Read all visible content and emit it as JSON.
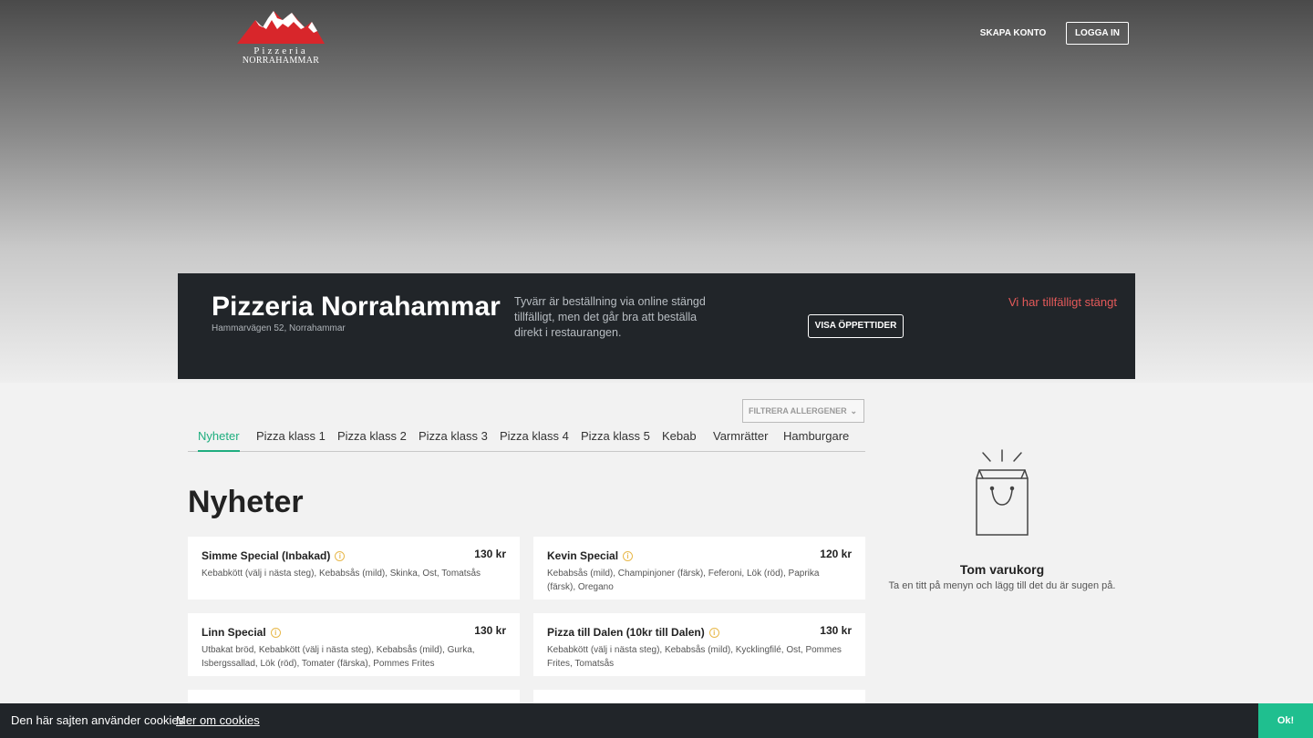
{
  "header": {
    "logo_line1": "Pizzeria",
    "logo_line2": "NORRAHAMMAR",
    "signup_label": "SKAPA KONTO",
    "login_label": "LOGGA IN"
  },
  "restaurant": {
    "name": "Pizzeria Norrahammar",
    "address": "Hammarvägen 52, Norrahammar",
    "closed_message": "Tyvärr är beställning via online stängd tillfälligt, men det går bra att beställa direkt i restaurangen.",
    "hours_button": "VISA ÖPPETTIDER",
    "status": "Vi har tillfälligt stängt"
  },
  "filter": {
    "allergen_label": "FILTRERA ALLERGENER",
    "chevron_icon": "chevron-down-icon"
  },
  "categories": [
    {
      "label": "Nyheter",
      "active": true
    },
    {
      "label": "Pizza klass 1",
      "active": false
    },
    {
      "label": "Pizza klass 2",
      "active": false
    },
    {
      "label": "Pizza klass 3",
      "active": false
    },
    {
      "label": "Pizza klass 4",
      "active": false
    },
    {
      "label": "Pizza klass 5",
      "active": false
    },
    {
      "label": "Kebab",
      "active": false
    },
    {
      "label": "Varmrätter",
      "active": false
    },
    {
      "label": "Hamburgare",
      "active": false
    }
  ],
  "section": {
    "title": "Nyheter"
  },
  "menu_items": [
    {
      "name": "Simme Special (Inbakad)",
      "price": "130 kr",
      "description": "Kebabkött (välj i nästa steg), Kebabsås (mild), Skinka, Ost, Tomatsås"
    },
    {
      "name": "Kevin Special",
      "price": "120 kr",
      "description": "Kebabsås (mild), Champinjoner (färsk), Feferoni, Lök (röd), Paprika (färsk), Oregano"
    },
    {
      "name": "Linn Special",
      "price": "130 kr",
      "description": "Utbakat bröd, Kebabkött (välj i nästa steg), Kebabsås (mild), Gurka, Isbergssallad, Lök (röd), Tomater (färska), Pommes Frites"
    },
    {
      "name": "Pizza till Dalen (10kr till Dalen)",
      "price": "130 kr",
      "description": "Kebabkött (välj i nästa steg), Kebabsås (mild), Kycklingfilé, Ost, Pommes Frites, Tomatsås"
    }
  ],
  "cart": {
    "title": "Tom varukorg",
    "subtitle": "Ta en titt på menyn och lägg till det du är sugen på.",
    "icon": "empty-bag-icon"
  },
  "cookie": {
    "text": "Den här sajten använder cookies",
    "link": "Mer om cookies",
    "ok": "Ok!"
  },
  "colors": {
    "accent": "#1fae7f",
    "dark": "#212529",
    "closed": "#e55a5a",
    "info_icon": "#e8b84a"
  }
}
